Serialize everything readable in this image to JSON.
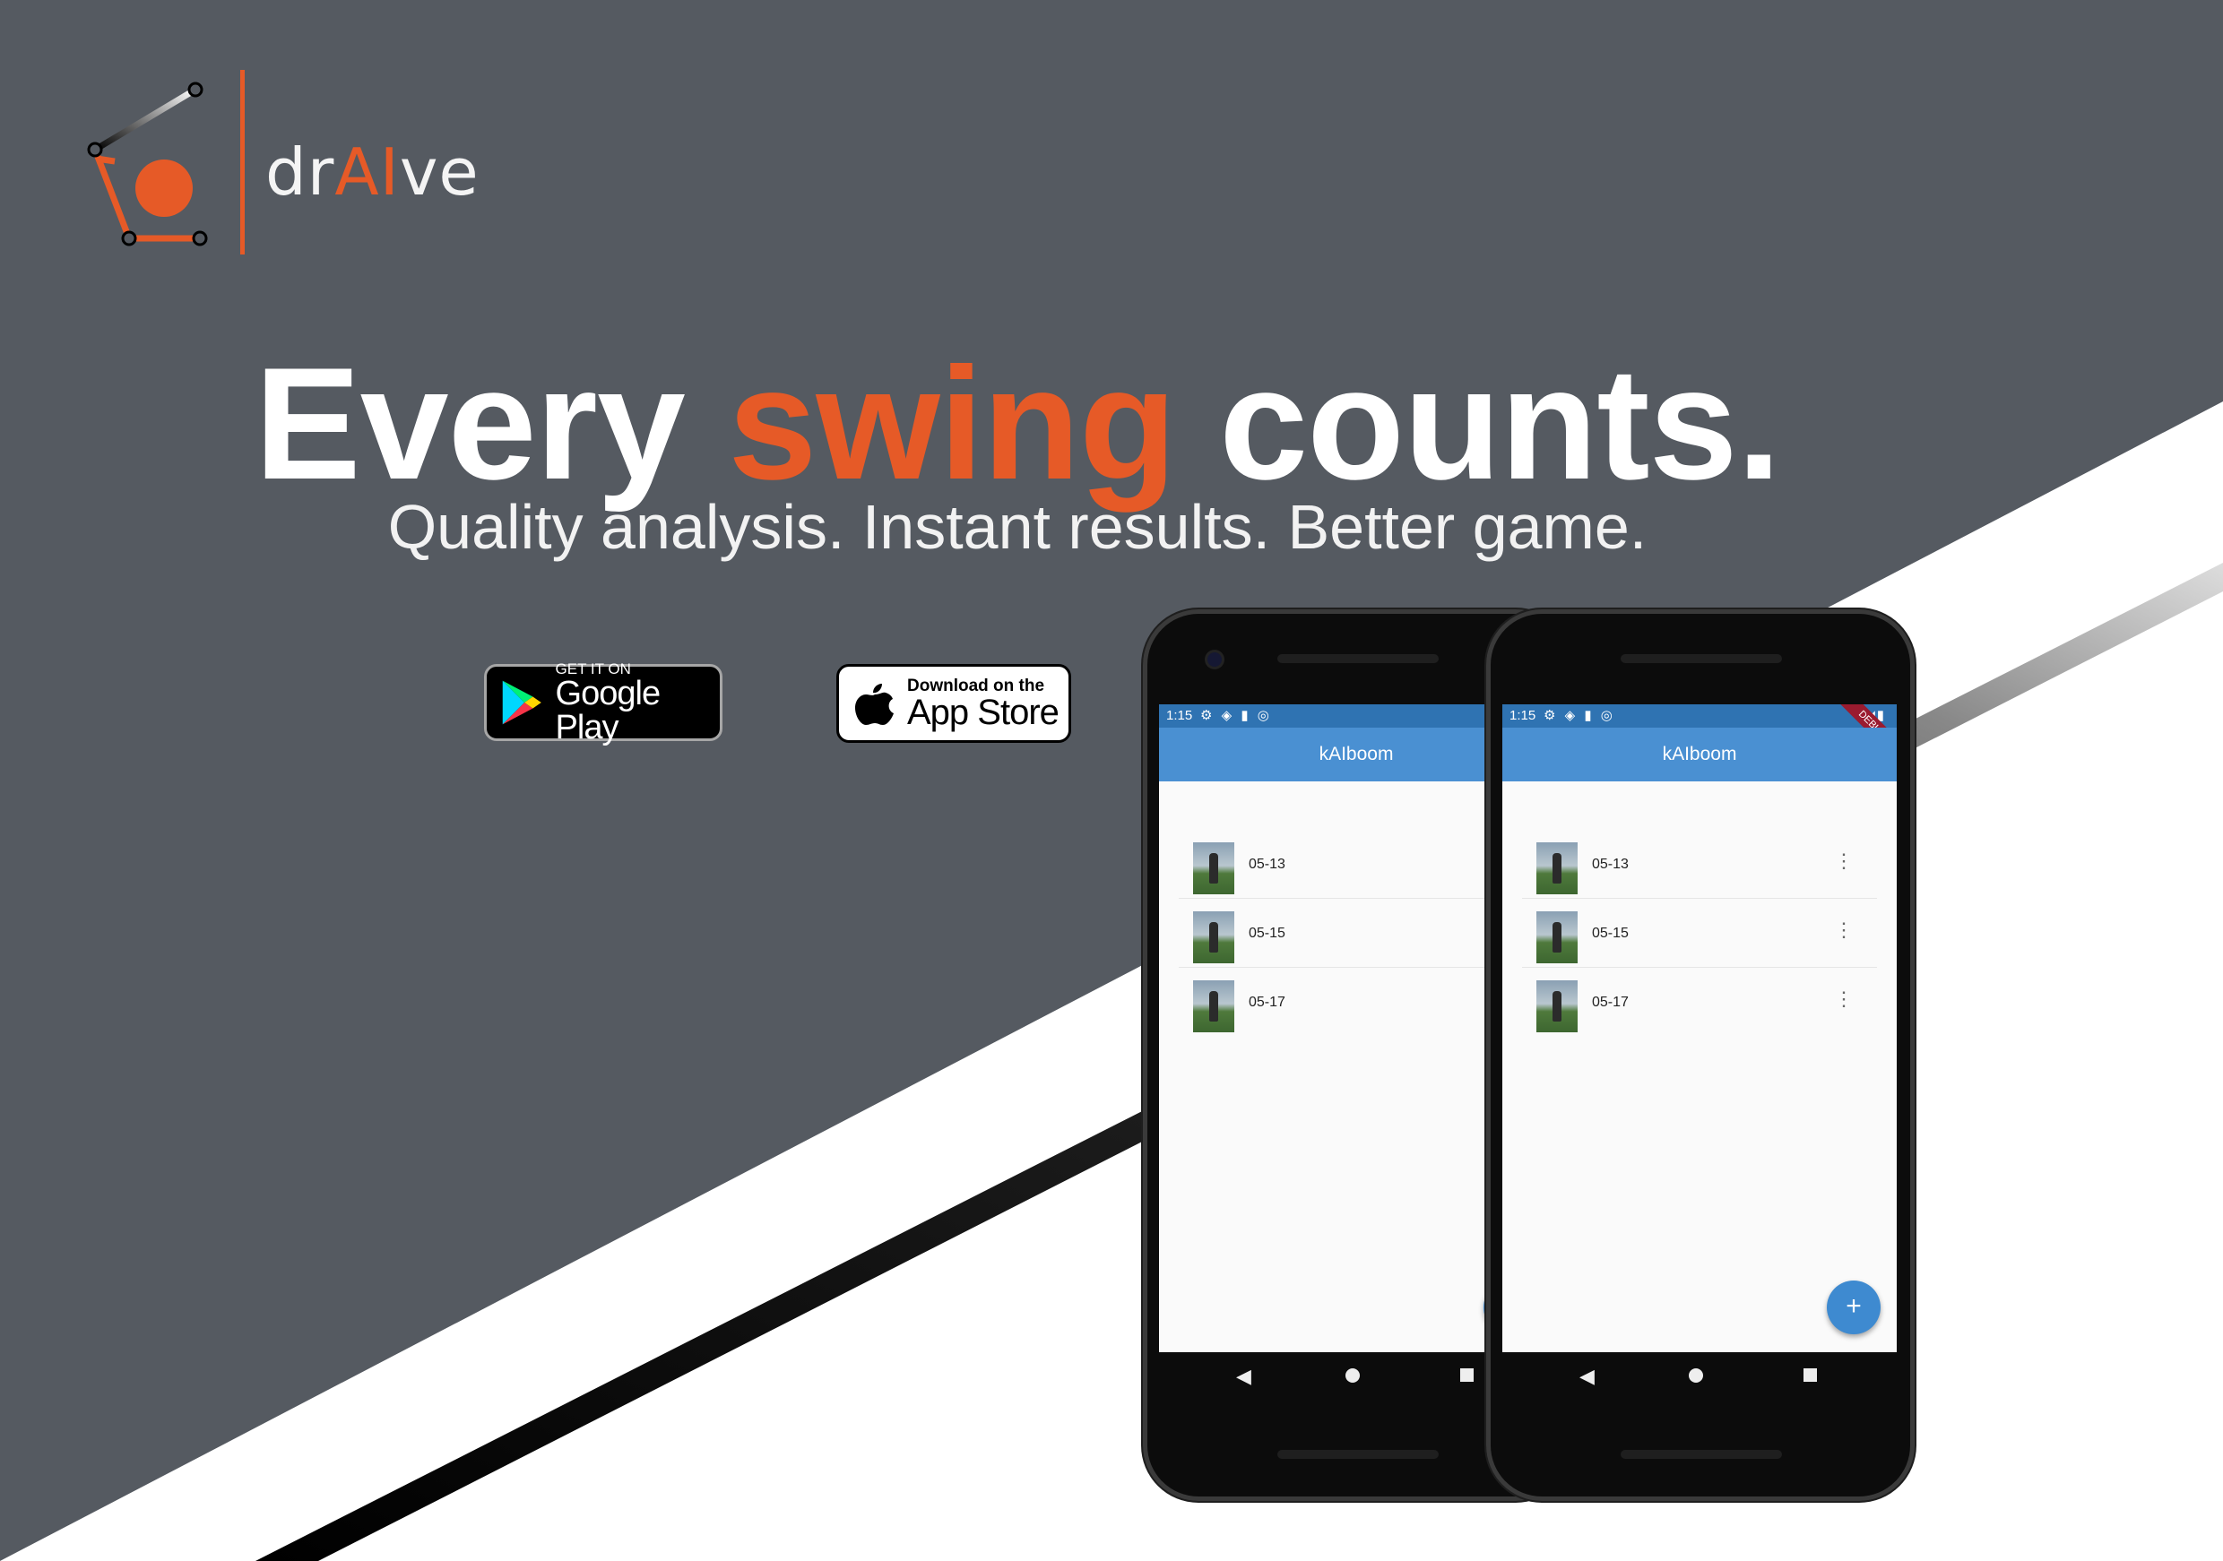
{
  "brand": {
    "name_prefix": "dr",
    "name_highlight": "AI",
    "name_suffix": "ve",
    "accent_color": "#e65a27",
    "background_color": "#555a61"
  },
  "hero": {
    "headline_part1": "Every ",
    "headline_accent": "swing",
    "headline_part2": " counts.",
    "subheadline": "Quality analysis. Instant results. Better game."
  },
  "stores": {
    "google": {
      "small": "GET IT ON",
      "big": "Google Play"
    },
    "apple": {
      "small": "Download on the",
      "big": "App Store"
    }
  },
  "app_screen": {
    "status_time": "1:15",
    "debug_label": "DEBUG",
    "app_title": "kAIboom",
    "items": [
      {
        "label": "05-13"
      },
      {
        "label": "05-15"
      },
      {
        "label": "05-17"
      }
    ],
    "fab_label": "+",
    "menu_glyph": "⋮"
  }
}
